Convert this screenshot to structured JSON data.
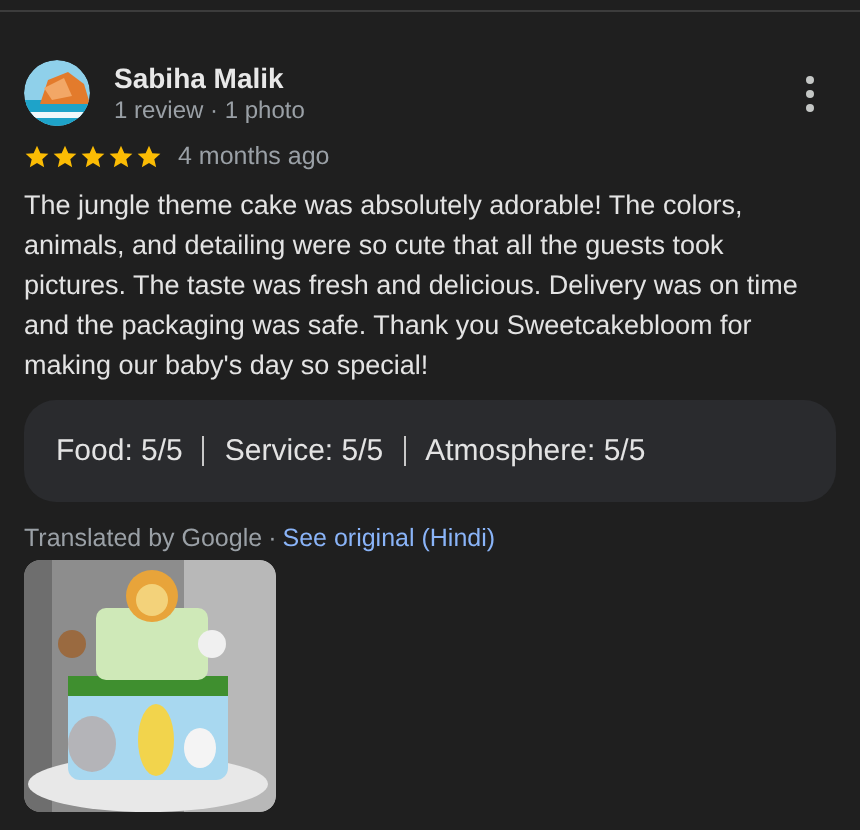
{
  "review": {
    "author": "Sabiha Malik",
    "author_meta": "1 review · 1 photo",
    "stars": 5,
    "time": "4 months ago",
    "text": "The jungle theme cake was absolutely adorable! The colors, animals, and detailing were so cute that all the guests took pictures. The taste was fresh and delicious. Delivery was on time and the packaging was safe. Thank you Sweetcakebloom for making our baby's day so special!",
    "ratings": [
      "Food: 5/5",
      "Service: 5/5",
      "Atmosphere: 5/5"
    ],
    "translated_by": "Translated by Google",
    "separator": "·",
    "see_original": "See original (Hindi)",
    "photos": [
      {
        "kind": "picture"
      }
    ]
  }
}
